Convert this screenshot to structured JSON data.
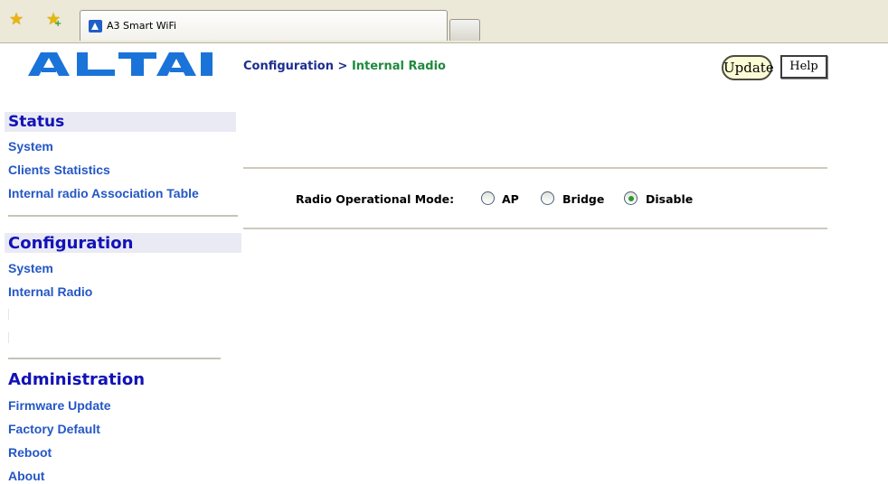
{
  "browser": {
    "tab_title": "A3 Smart WiFi",
    "icons": [
      "favorites-star-icon",
      "add-favorite-icon",
      "site-favicon",
      "new-tab-button"
    ]
  },
  "brand": {
    "logo_text": "ALTAI",
    "logo_color": "#1a73d8"
  },
  "sidebar": {
    "status": {
      "heading": "Status",
      "items": [
        "System",
        "Clients Statistics",
        "Internal radio Association Table"
      ]
    },
    "configuration": {
      "heading": "Configuration",
      "items": [
        "System",
        "Internal Radio"
      ]
    },
    "administration": {
      "heading": "Administration",
      "items": [
        "Firmware Update",
        "Factory Default",
        "Reboot",
        "About"
      ]
    }
  },
  "main": {
    "breadcrumb": {
      "section": "Configuration",
      "separator": ">",
      "page": "Internal Radio"
    },
    "update_button": "Update",
    "help_button": "Help",
    "radio_mode": {
      "label": "Radio Operational Mode:",
      "options": [
        "AP",
        "Bridge",
        "Disable"
      ],
      "selected": "Disable"
    }
  },
  "colors": {
    "link": "#2457c5",
    "heading": "#1212b8",
    "breadcrumb_page": "#1e8a3c"
  }
}
